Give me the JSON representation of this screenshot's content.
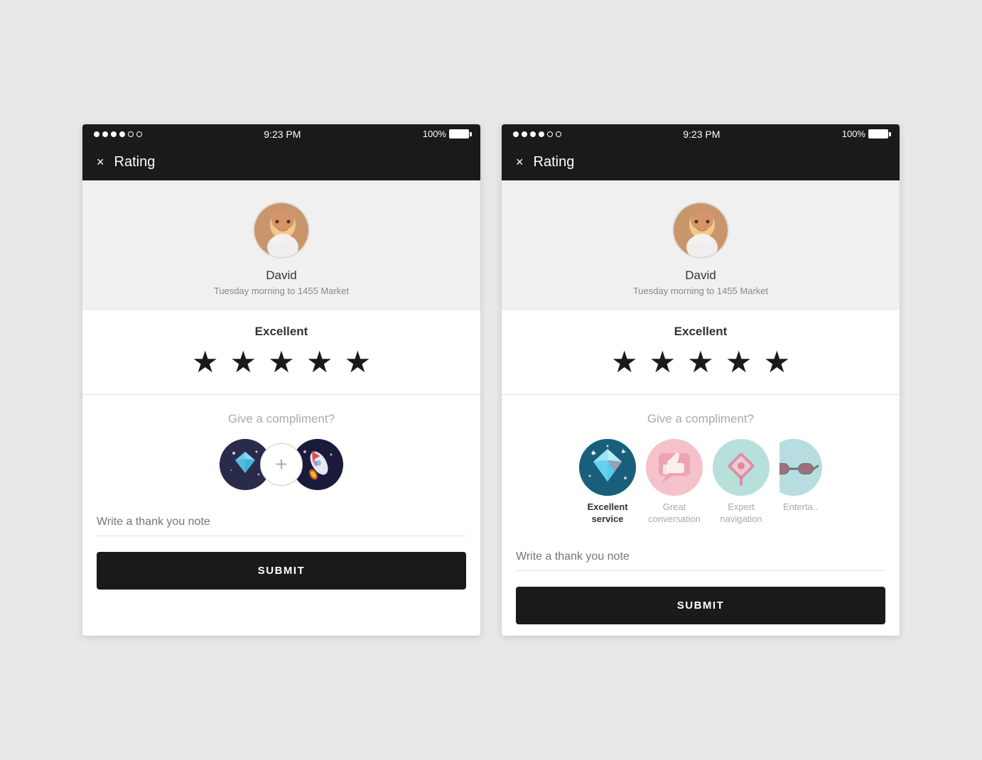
{
  "screens": [
    {
      "id": "left-screen",
      "statusBar": {
        "dots": [
          true,
          true,
          true,
          true,
          false,
          false
        ],
        "time": "9:23 PM",
        "battery": "100%"
      },
      "header": {
        "closeLabel": "×",
        "title": "Rating"
      },
      "profile": {
        "driverName": "David",
        "tripInfo": "Tuesday morning to 1455 Market"
      },
      "rating": {
        "label": "Excellent",
        "stars": 5
      },
      "compliment": {
        "label": "Give a compliment?",
        "state": "empty"
      },
      "note": {
        "placeholder": "Write a thank you note"
      },
      "submitLabel": "SUBMIT"
    },
    {
      "id": "right-screen",
      "statusBar": {
        "dots": [
          true,
          true,
          true,
          true,
          false,
          false
        ],
        "time": "9:23 PM",
        "battery": "100%"
      },
      "header": {
        "closeLabel": "×",
        "title": "Rating"
      },
      "profile": {
        "driverName": "David",
        "tripInfo": "Tuesday morning to 1455 Market"
      },
      "rating": {
        "label": "Excellent",
        "stars": 5
      },
      "compliment": {
        "label": "Give a compliment?",
        "state": "selected",
        "options": [
          {
            "label": "Excellent service",
            "selected": true,
            "type": "diamond"
          },
          {
            "label": "Great conversation",
            "selected": false,
            "type": "thumb"
          },
          {
            "label": "Expert navigation",
            "selected": false,
            "type": "mappin"
          },
          {
            "label": "Entertaining driver",
            "selected": false,
            "type": "glasses"
          }
        ]
      },
      "note": {
        "placeholder": "Write a thank you note"
      },
      "submitLabel": "SUBMIT"
    }
  ]
}
